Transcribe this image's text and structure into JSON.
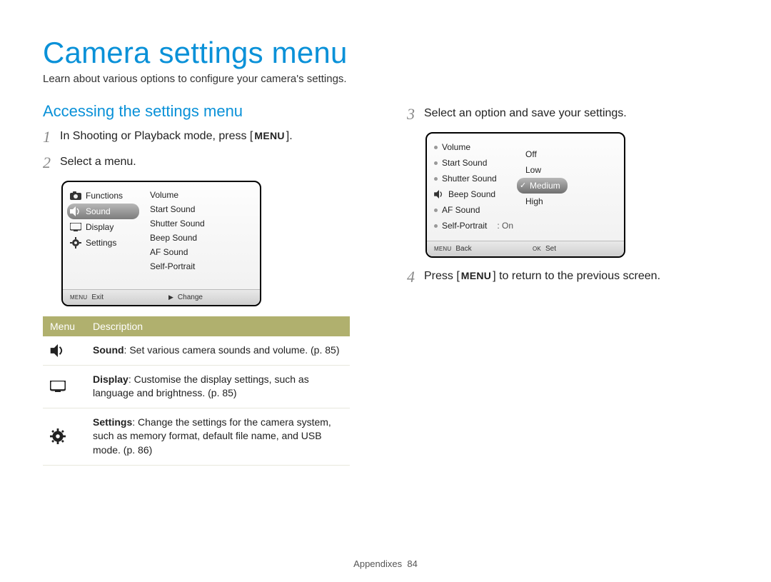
{
  "page": {
    "title": "Camera settings menu",
    "subtitle": "Learn about various options to configure your camera's settings.",
    "footer_section": "Appendixes",
    "footer_page": "84"
  },
  "section_heading": "Accessing the settings menu",
  "steps": {
    "s1": {
      "num": "1",
      "pre": "In Shooting or Playback mode, press [",
      "btn": "MENU",
      "post": "]."
    },
    "s2": {
      "num": "2",
      "text": "Select a menu."
    },
    "s3": {
      "num": "3",
      "text": "Select an option and save your settings."
    },
    "s4": {
      "num": "4",
      "pre": "Press [",
      "btn": "MENU",
      "post": "] to return to the previous screen."
    }
  },
  "lcd1": {
    "left": {
      "functions": "Functions",
      "sound": "Sound",
      "display": "Display",
      "settings": "Settings"
    },
    "right": {
      "volume": "Volume",
      "start": "Start Sound",
      "shutter": "Shutter Sound",
      "beep": "Beep Sound",
      "af": "AF Sound",
      "selfp": "Self-Portrait"
    },
    "footer": {
      "left_btn": "MENU",
      "left_label": "Exit",
      "right_sym": "▶",
      "right_label": "Change"
    }
  },
  "lcd2": {
    "left": {
      "volume": "Volume",
      "start": "Start Sound",
      "shutter": "Shutter Sound",
      "beep": "Beep Sound",
      "af": "AF Sound",
      "selfp": "Self-Portrait",
      "selfp_val": ": On"
    },
    "right": {
      "off": "Off",
      "low": "Low",
      "medium": "Medium",
      "high": "High"
    },
    "footer": {
      "left_btn": "MENU",
      "left_label": "Back",
      "right_btn": "OK",
      "right_label": "Set"
    }
  },
  "table": {
    "hdr_menu": "Menu",
    "hdr_desc": "Description",
    "rows": {
      "sound": {
        "bold": "Sound",
        "rest": ": Set various camera sounds and volume. (p. 85)"
      },
      "display": {
        "bold": "Display",
        "rest": ": Customise the display settings, such as language and brightness. (p. 85)"
      },
      "settings": {
        "bold": "Settings",
        "rest": ": Change the settings for the camera system, such as memory format, default file name, and USB mode. (p. 86)"
      }
    }
  }
}
